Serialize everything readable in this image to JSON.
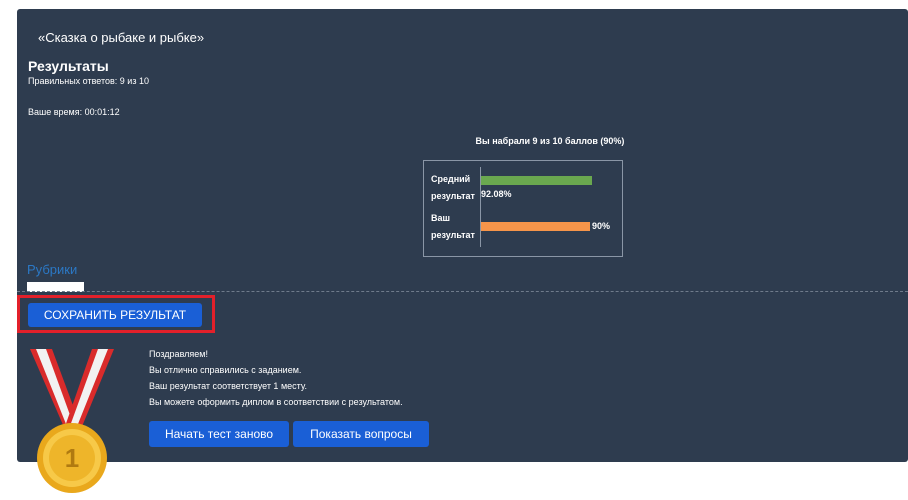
{
  "quiz": {
    "title": "«Сказка о рыбаке и рыбке»"
  },
  "results": {
    "heading": "Результаты",
    "correct_answers": "Правильных ответов: 9 из 10",
    "time": "Ваше время: 00:01:12",
    "score_heading": "Вы набрали 9 из 10 баллов (90%)"
  },
  "chart_data": {
    "type": "bar",
    "orientation": "horizontal",
    "categories": [
      "Средний результат",
      "Ваш результат"
    ],
    "values": [
      92.08,
      90
    ],
    "value_labels": [
      "92.08%",
      "90%"
    ],
    "colors": [
      "#6aa84f",
      "#f6954a"
    ],
    "xlim": [
      0,
      100
    ]
  },
  "rubrics": {
    "label": "Рубрики"
  },
  "buttons": {
    "save": "СОХРАНИТЬ РЕЗУЛЬТАТ",
    "restart": "Начать тест заново",
    "show_questions": "Показать вопросы"
  },
  "congrats": {
    "line1": "Поздравляем!",
    "line2": "Вы отлично справились с заданием.",
    "line3": "Ваш результат соответствует 1 месту.",
    "line4": "Вы можете оформить диплом в соответствии с результатом."
  },
  "medal": {
    "icon": "gold-medal-icon",
    "place": "1"
  },
  "colors": {
    "panel_bg": "#2e3c4f",
    "button_bg": "#1a5fd6",
    "highlight": "#e3202a",
    "link": "#2b78c5"
  }
}
